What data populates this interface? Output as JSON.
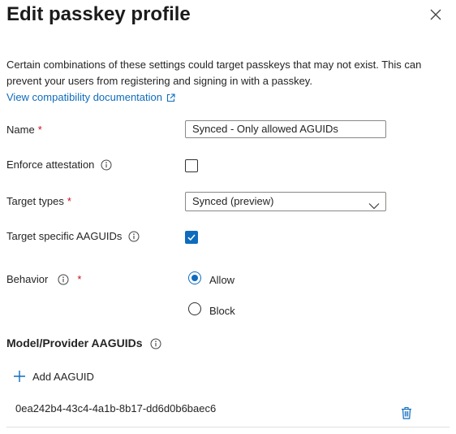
{
  "panel": {
    "title": "Edit passkey profile",
    "description": "Certain combinations of these settings could target passkeys that may not exist. This can prevent your users from registering and signing in with a passkey.",
    "doc_link": "View compatibility documentation"
  },
  "form": {
    "name": {
      "label": "Name",
      "required_mark": "*",
      "value": "Synced - Only allowed AGUIDs"
    },
    "enforce_attestation": {
      "label": "Enforce attestation",
      "checked": false
    },
    "target_types": {
      "label": "Target types",
      "required_mark": "*",
      "selected": "Synced (preview)"
    },
    "target_specific": {
      "label": "Target specific AAGUIDs",
      "checked": true
    },
    "behavior": {
      "label": "Behavior",
      "required_mark": "*",
      "options": [
        "Allow",
        "Block"
      ],
      "selected": "Allow"
    }
  },
  "aaguids": {
    "section_title": "Model/Provider AAGUIDs",
    "add_label": "Add AAGUID",
    "items": [
      "0ea242b4-43c4-4a1b-8b17-dd6d0b6baec6"
    ]
  },
  "colors": {
    "accent": "#0f6cbd",
    "required": "#c50f1f"
  }
}
